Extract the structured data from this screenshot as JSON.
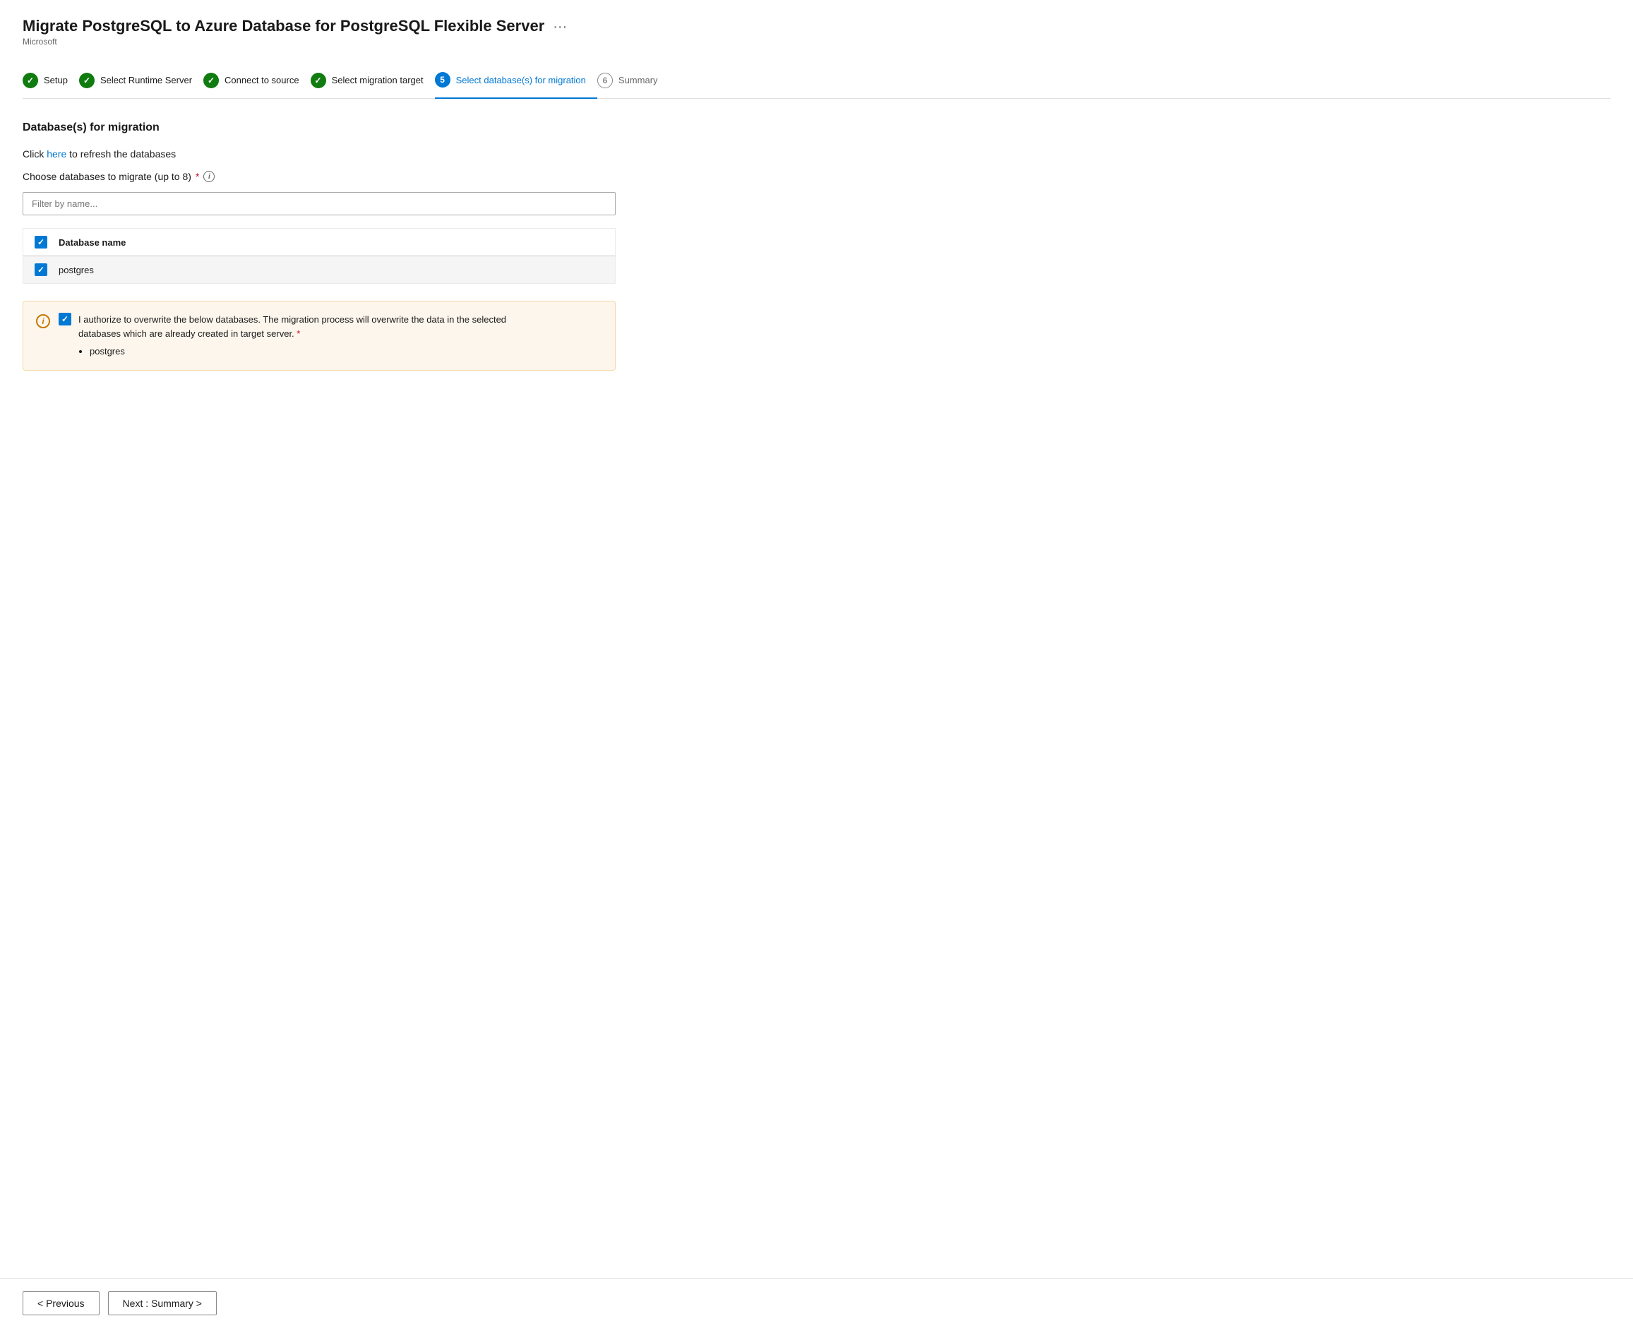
{
  "header": {
    "title": "Migrate PostgreSQL to Azure Database for PostgreSQL Flexible Server",
    "subtitle": "Microsoft",
    "more_options_icon": "···"
  },
  "wizard": {
    "steps": [
      {
        "id": "setup",
        "label": "Setup",
        "state": "completed",
        "icon_type": "green-check",
        "number": "1"
      },
      {
        "id": "runtime-server",
        "label": "Select Runtime Server",
        "state": "completed",
        "icon_type": "green-check",
        "number": "2"
      },
      {
        "id": "connect-source",
        "label": "Connect to source",
        "state": "completed",
        "icon_type": "green-check",
        "number": "3"
      },
      {
        "id": "migration-target",
        "label": "Select migration target",
        "state": "completed",
        "icon_type": "green-check",
        "number": "4"
      },
      {
        "id": "select-databases",
        "label": "Select database(s) for migration",
        "state": "active",
        "icon_type": "blue-active",
        "number": "5"
      },
      {
        "id": "summary",
        "label": "Summary",
        "state": "inactive",
        "icon_type": "circle-num",
        "number": "6"
      }
    ]
  },
  "content": {
    "section_title": "Database(s) for migration",
    "refresh_text_before": "Click ",
    "refresh_link": "here",
    "refresh_text_after": " to refresh the databases",
    "choose_label": "Choose databases to migrate (up to 8)",
    "required_marker": "*",
    "filter_placeholder": "Filter by name...",
    "table": {
      "header_checkbox": true,
      "column_label": "Database name",
      "rows": [
        {
          "checked": true,
          "name": "postgres"
        }
      ]
    },
    "warning": {
      "text1": "I authorize to overwrite the below databases. The migration process will overwrite the data in the selected",
      "text2": "databases which are already created in target server.",
      "required_marker": "*",
      "databases": [
        "postgres"
      ]
    }
  },
  "footer": {
    "previous_label": "< Previous",
    "next_label": "Next : Summary >"
  }
}
